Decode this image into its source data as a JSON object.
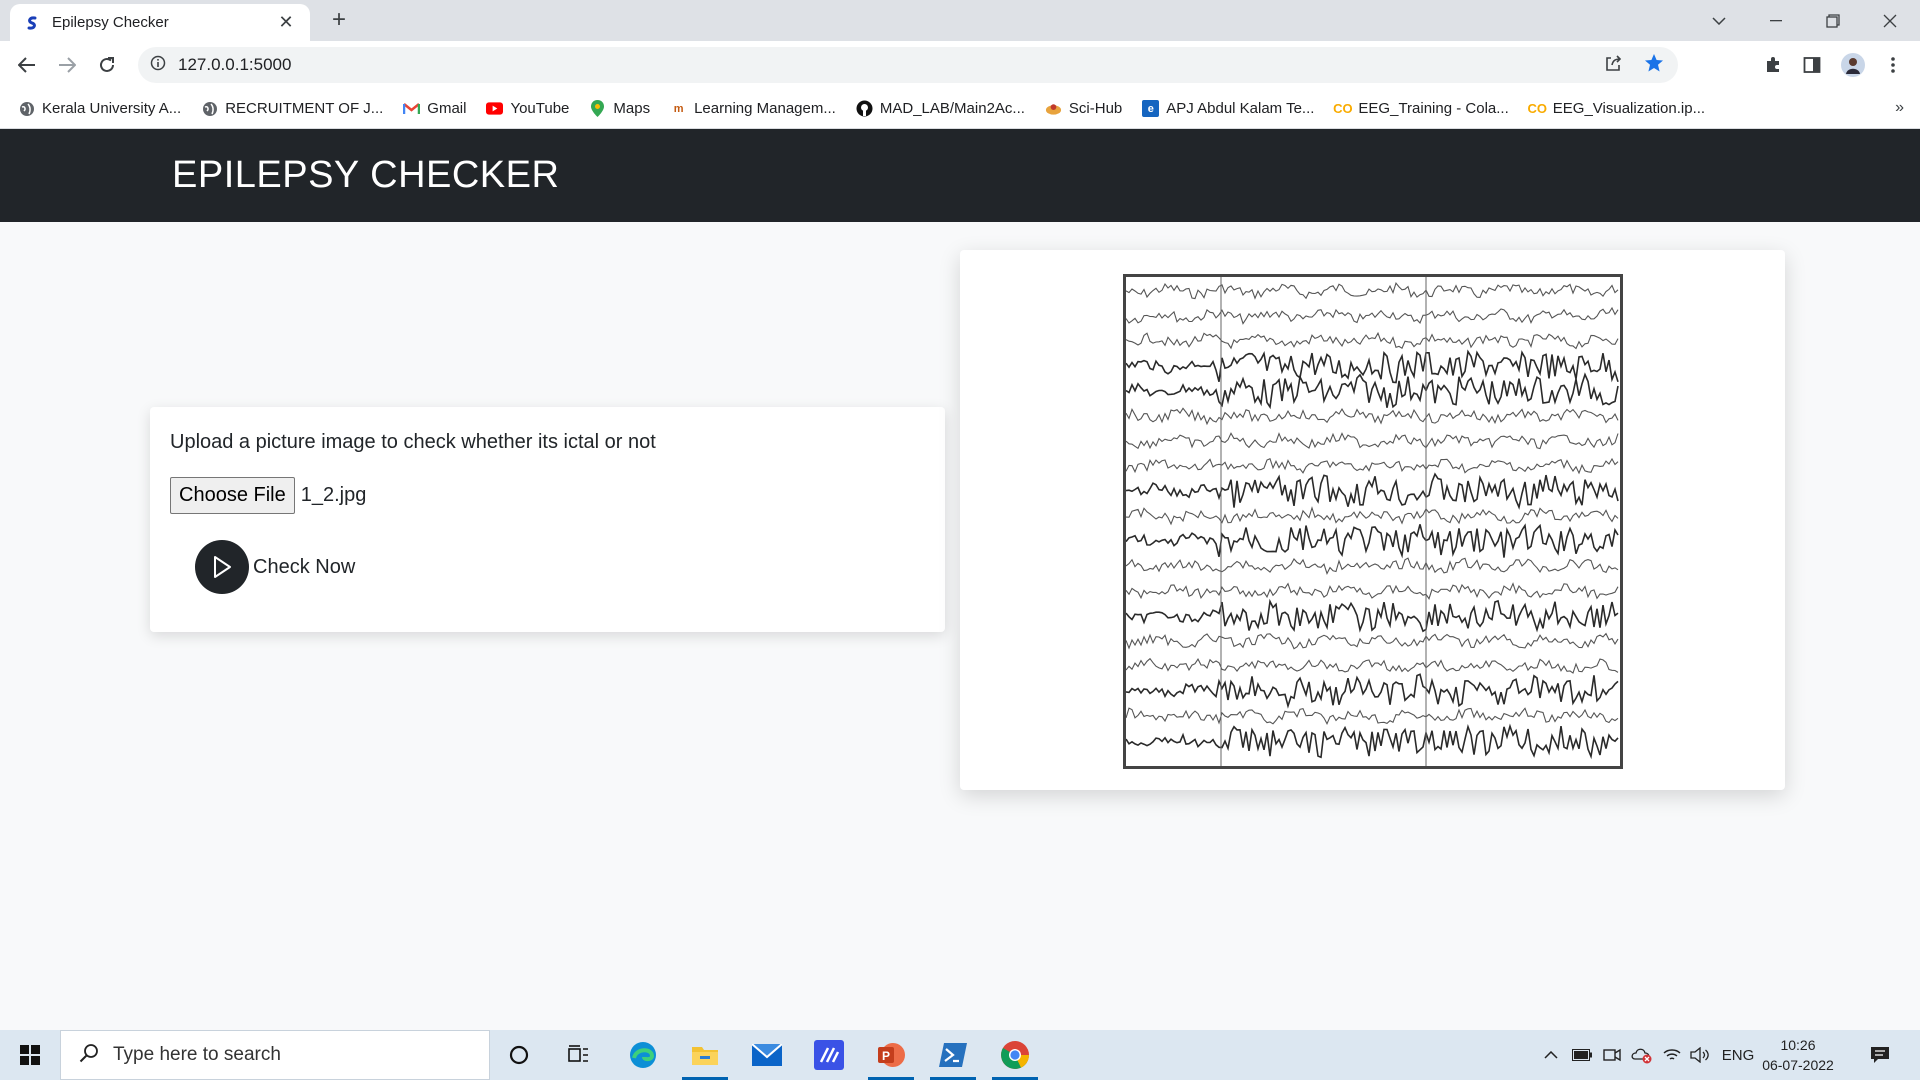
{
  "browser": {
    "tab_title": "Epilepsy Checker",
    "tab_close": "✕",
    "new_tab": "+",
    "url": "127.0.0.1:5000",
    "bookmarks": [
      {
        "label": "Kerala University A...",
        "icon": "globe-icon"
      },
      {
        "label": "RECRUITMENT OF J...",
        "icon": "globe-icon"
      },
      {
        "label": "Gmail",
        "icon": "gmail-icon"
      },
      {
        "label": "YouTube",
        "icon": "youtube-icon"
      },
      {
        "label": "Maps",
        "icon": "maps-icon"
      },
      {
        "label": "Learning Managem...",
        "icon": "lms-icon"
      },
      {
        "label": "MAD_LAB/Main2Ac...",
        "icon": "github-icon"
      },
      {
        "label": "Sci-Hub",
        "icon": "scihub-icon"
      },
      {
        "label": "APJ Abdul Kalam Te...",
        "icon": "ktu-icon"
      },
      {
        "label": "EEG_Training - Cola...",
        "icon": "colab-icon"
      },
      {
        "label": "EEG_Visualization.ip...",
        "icon": "colab-icon"
      }
    ],
    "bookmarks_more": "»"
  },
  "page": {
    "title": "EPILEPSY CHECKER",
    "upload_prompt": "Upload a picture image to check whether its ictal or not",
    "choose_file_label": "Choose File",
    "file_name": "1_2.jpg",
    "check_label": "Check Now"
  },
  "taskbar": {
    "search_placeholder": "Type here to search",
    "language": "ENG",
    "time": "10:26",
    "date": "06-07-2022"
  },
  "colors": {
    "header_bg": "#212529",
    "page_bg": "#f8f9fa",
    "accent_blue": "#1a73e8"
  }
}
